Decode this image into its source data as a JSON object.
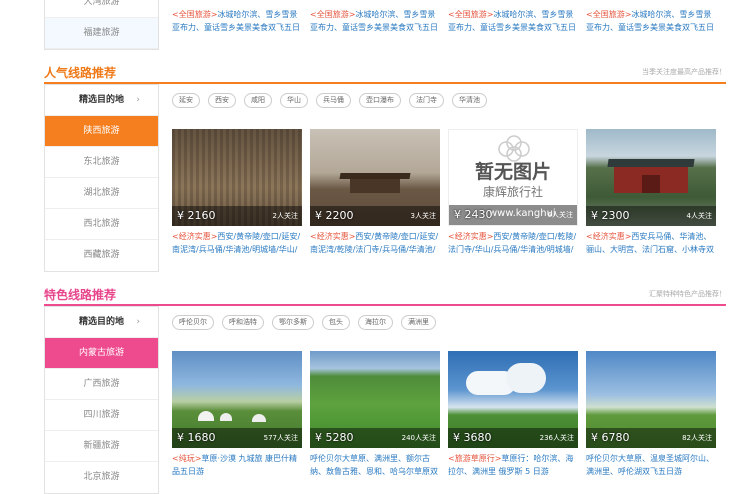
{
  "top": {
    "cat_items": [
      "大湾旅游",
      "福建旅游"
    ],
    "cards": [
      {
        "hl": "<全国旅游>",
        "desc": "冰城哈尔滨、雪乡雪景亚布力、童话雪乡美景美食双飞五日"
      },
      {
        "hl": "<全国旅游>",
        "desc": "冰城哈尔滨、雪乡雪景亚布力、童话雪乡美景美食双飞五日"
      },
      {
        "hl": "<全国旅游>",
        "desc": "冰城哈尔滨、雪乡雪景亚布力、童话雪乡美景美食双飞五日"
      },
      {
        "hl": "<全国旅游>",
        "desc": "冰城哈尔滨、雪乡雪景亚布力、童话雪乡美景美食双飞五日"
      }
    ]
  },
  "popular": {
    "title": "人气线路推荐",
    "note": "当季关注度最高产品推荐！",
    "header": "精选目的地",
    "chev": "›",
    "cats": [
      "陕西旅游",
      "东北旅游",
      "湖北旅游",
      "西北旅游",
      "西藏旅游"
    ],
    "tags": [
      "延安",
      "西安",
      "咸阳",
      "华山",
      "兵马俑",
      "壶口瀑布",
      "法门寺",
      "华清池"
    ],
    "cards": [
      {
        "price": "¥ 2160",
        "follow": "2人关注",
        "hl": "<经济实惠>",
        "desc": "西安/黄帝陵/壶口/延安/南泥湾/兵马俑/华清池/明城墙/华山/"
      },
      {
        "price": "¥ 2200",
        "follow": "3人关注",
        "hl": "<经济实惠>",
        "desc": "西安/黄帝陵/壶口/延安/南泥湾/乾陵/法门寺/兵马俑/华清池/"
      },
      {
        "price": "¥ 2430",
        "follow": "6人关注",
        "hl": "<经济实惠>",
        "desc": "西安/黄帝陵/壶口/乾陵/法门寺/华山/兵马俑/华清池/明城墙/"
      },
      {
        "price": "¥ 2300",
        "follow": "4人关注",
        "hl": "<经济实惠>",
        "desc": "西安兵马俑、华清池、骊山、大明宫、法门石窟、小林寺双"
      }
    ],
    "nopic": {
      "main": "暂无图片",
      "sub": "康辉旅行社",
      "url": "www.kanghui"
    }
  },
  "special": {
    "title": "特色线路推荐",
    "note": "汇聚特种特色产品推荐！",
    "header": "精选目的地",
    "chev": "›",
    "cats": [
      "内蒙古旅游",
      "广西旅游",
      "四川旅游",
      "新疆旅游",
      "北京旅游"
    ],
    "tags": [
      "呼伦贝尔",
      "呼和浩特",
      "鄂尔多斯",
      "包头",
      "海拉尔",
      "满洲里"
    ],
    "cards": [
      {
        "price": "¥ 1680",
        "follow": "577人关注",
        "hl": "<纯玩>",
        "desc": "草原·沙漠 九城旅 康巴什精品五日游"
      },
      {
        "price": "¥ 5280",
        "follow": "240人关注",
        "hl": "",
        "desc": "呼伦贝尔大草原、满洲里、额尔古纳、敖鲁古雅、恩和、哈乌尔草原双"
      },
      {
        "price": "¥ 3680",
        "follow": "236人关注",
        "hl": "<旅游草原行>",
        "desc": "草原行：哈尔滨、海拉尔、满洲里 俄罗斯 5 日游"
      },
      {
        "price": "¥ 6780",
        "follow": "82人关注",
        "hl": "",
        "desc": "呼伦贝尔大草原、温泉圣城阿尔山、满洲里、呼伦湖双飞五日游"
      }
    ]
  },
  "colors": {
    "orange": "#f57e1e",
    "pink": "#ee4b8f",
    "link": "#2a7ac1",
    "highlight": "#e5533c"
  }
}
